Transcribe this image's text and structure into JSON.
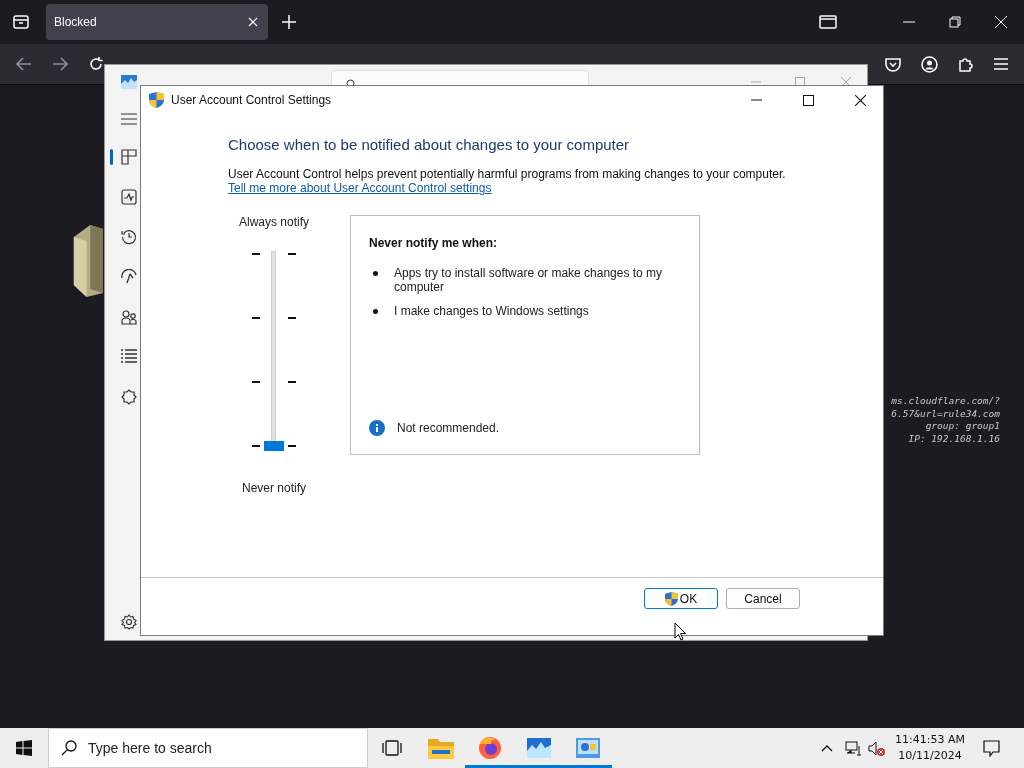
{
  "browser": {
    "tabs": [
      {
        "title": "Blocked",
        "selected": true
      }
    ],
    "page_text": [
      "ms.cloudflare.com/?",
      "6.57&url=rule34.com",
      "group: group1",
      "IP: 192.168.1.16"
    ]
  },
  "task_manager": {
    "nav": [
      {
        "kind": "processes",
        "selected": true
      },
      {
        "kind": "performance",
        "selected": false
      },
      {
        "kind": "history",
        "selected": false
      },
      {
        "kind": "startup",
        "selected": false
      },
      {
        "kind": "users",
        "selected": false
      },
      {
        "kind": "details",
        "selected": false
      },
      {
        "kind": "services",
        "selected": false
      }
    ]
  },
  "dialog": {
    "title": "User Account Control Settings",
    "heading": "Choose when to be notified about changes to your computer",
    "description": "User Account Control helps prevent potentially harmful programs from making changes to your computer.",
    "link": "Tell me more about User Account Control settings",
    "slider": {
      "top_label": "Always notify",
      "bottom_label": "Never notify",
      "level": 0
    },
    "info": {
      "title": "Never notify me when:",
      "bullets": [
        "Apps try to install software or make changes to my computer",
        "I make changes to Windows settings"
      ],
      "note": "Not recommended."
    },
    "buttons": [
      {
        "label": "OK",
        "kind": "shield",
        "default": true
      },
      {
        "label": "Cancel",
        "kind": "plain",
        "default": false
      }
    ]
  },
  "taskbar": {
    "search": {
      "placeholder": "Type here to search"
    },
    "apps": [
      {
        "kind": "explorer",
        "running": false
      },
      {
        "kind": "firefox",
        "running": true
      },
      {
        "kind": "taskmanager",
        "running": true
      },
      {
        "kind": "uac",
        "running": true
      }
    ],
    "time": "11:41:53 AM",
    "date": "10/11/2024"
  }
}
